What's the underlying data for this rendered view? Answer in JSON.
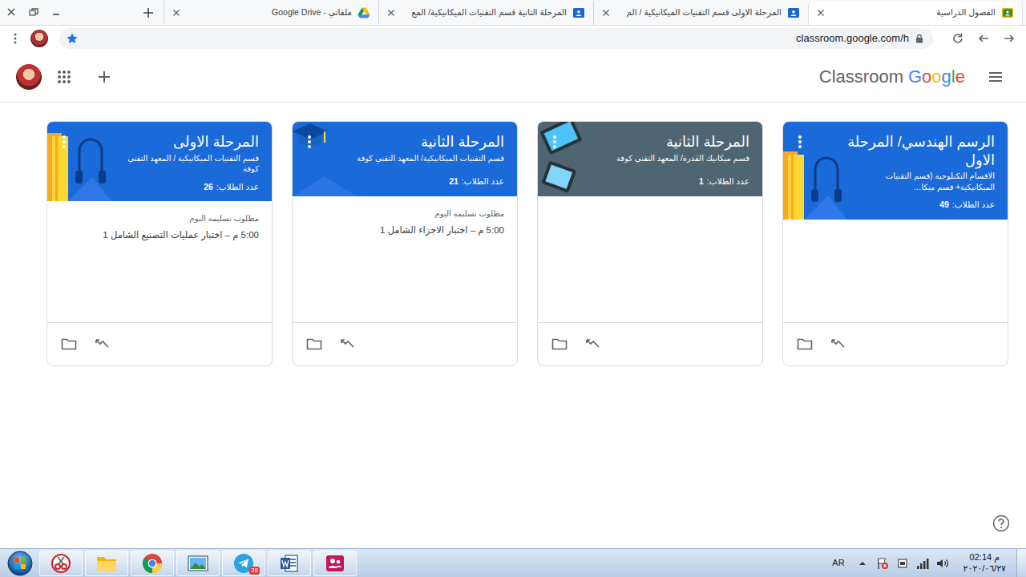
{
  "tabs": [
    {
      "label": "الفصول الدراسية",
      "selected": true,
      "kind": "classroom"
    },
    {
      "label": "المرحلة الاولى قسم التقنيات الميكانيكية / الم",
      "selected": false,
      "kind": "class"
    },
    {
      "label": "المرحلة الثانية قسم التقنيات الميكانيكية/ المع",
      "selected": false,
      "kind": "class"
    },
    {
      "label": "ملفاتي - Google Drive",
      "selected": false,
      "kind": "drive"
    }
  ],
  "address_bar": {
    "url": "classroom.google.com/h",
    "bookmarked": true
  },
  "app_header": {
    "brand": "Google",
    "product": "Classroom"
  },
  "classes": [
    {
      "title": "الرسم الهندسي/ المرحلة الاول",
      "subtitle": "الاقسام التكنلوجية (قسم التقنيات الميكانيكية+ قسم ميكا…",
      "students_label": "عدد الطلاب:",
      "students": "49",
      "color": "#1a6ad9",
      "kind": "books"
    },
    {
      "title": "المرحلة الثانية",
      "subtitle": "قسم ميكانيك القدرة/ المعهد التقني كوفة",
      "students_label": "عدد الطلاب:",
      "students": "1",
      "color": "#4f6573",
      "kind": "tablets"
    },
    {
      "title": "المرحلة الثانية",
      "subtitle": "قسم التقنيات الميكانيكية/ المعهد التقني كوفة",
      "students_label": "عدد الطلاب:",
      "students": "21",
      "color": "#1a6ad9",
      "kind": "graduation",
      "due": {
        "label": "مطلوب تسليمه اليوم",
        "items": [
          "5:00 م – اختبار الاجزاء الشامل 1"
        ]
      }
    },
    {
      "title": "المرحلة الاولى",
      "subtitle": "قسم التقنيات الميكانيكية / المعهد التقني كوفة",
      "students_label": "عدد الطلاب:",
      "students": "26",
      "color": "#1a6ad9",
      "kind": "books",
      "due": {
        "label": "مطلوب تسليمه اليوم",
        "items": [
          "5:00 م – اختبار عمليات التصنيع الشامل 1"
        ]
      }
    }
  ],
  "taskbar": {
    "apps": [
      {
        "kind": "snipping"
      },
      {
        "kind": "explorer"
      },
      {
        "kind": "chrome"
      },
      {
        "kind": "photos"
      },
      {
        "kind": "telegram",
        "badge": "38"
      },
      {
        "kind": "word"
      },
      {
        "kind": "meeting"
      }
    ],
    "language": "AR",
    "time": "02:14 م",
    "date": "٢٠٢٠/٠٦/٢٧"
  }
}
